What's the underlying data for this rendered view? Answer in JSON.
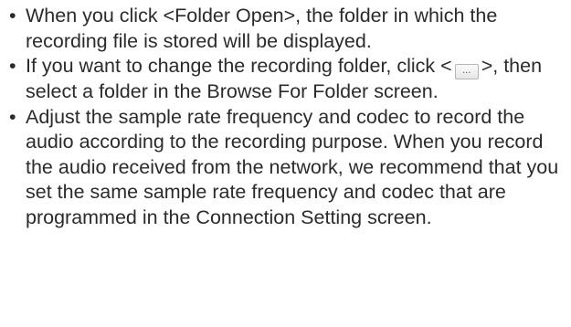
{
  "bullet_symbol": "•",
  "items": [
    {
      "text": "When you click <Folder Open>, the folder in which the recording file is stored will be displayed."
    },
    {
      "before": "If you want to change the recording folder, click <",
      "button_label": "...",
      "after": ">, then select a folder in the Browse For Folder screen."
    },
    {
      "text": "Adjust the sample rate frequency and codec to record the audio according to the recording purpose. When you record the audio received from the network, we recommend that you set the same sample rate frequency and codec that are programmed in the Connection Setting screen."
    }
  ]
}
